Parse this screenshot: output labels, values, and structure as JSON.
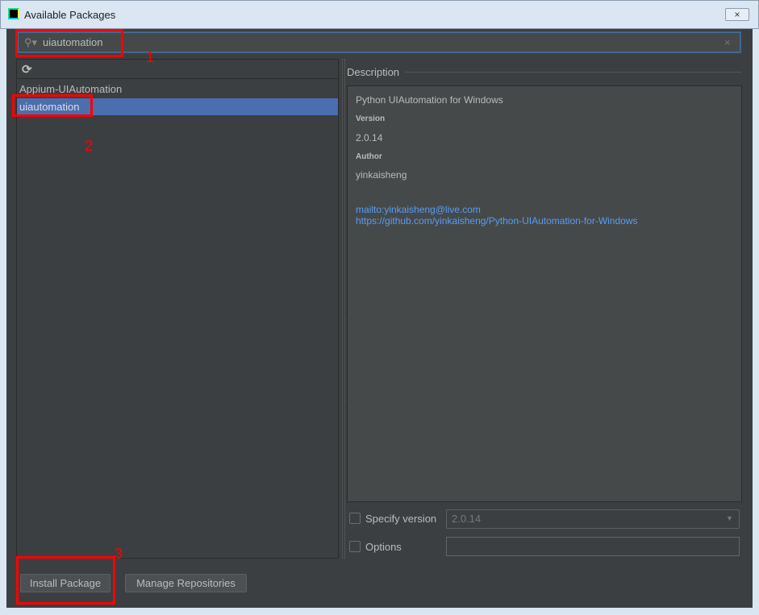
{
  "window": {
    "title": "Available Packages",
    "close_icon": "×"
  },
  "search": {
    "value": "uiautomation",
    "clear_icon": "×"
  },
  "packages": [
    {
      "name": "Appium-UIAutomation",
      "selected": false
    },
    {
      "name": "uiautomation",
      "selected": true
    }
  ],
  "description": {
    "label": "Description",
    "summary": "Python UIAutomation for Windows",
    "version_label": "Version",
    "version": "2.0.14",
    "author_label": "Author",
    "author": "yinkaisheng",
    "links": [
      "mailto:yinkaisheng@live.com",
      "https://github.com/yinkaisheng/Python-UIAutomation-for-Windows"
    ]
  },
  "specify_version": {
    "label": "Specify version",
    "checked": false,
    "value": "2.0.14"
  },
  "options": {
    "label": "Options",
    "checked": false,
    "value": ""
  },
  "buttons": {
    "install": "Install Package",
    "manage": "Manage Repositories"
  },
  "annotations": [
    "1",
    "2",
    "3"
  ],
  "colors": {
    "background": "#3c3f41",
    "selection": "#4b6eaf",
    "link": "#589df6",
    "annotation": "#ff0000"
  }
}
